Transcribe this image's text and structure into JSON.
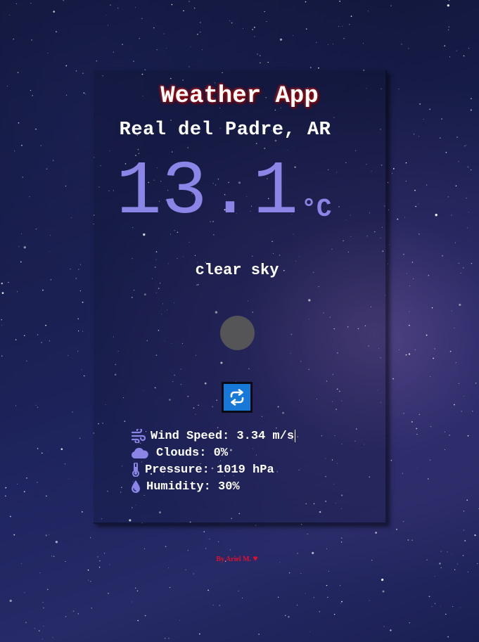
{
  "app": {
    "title": "Weather App",
    "location": "Real del Padre, AR"
  },
  "current": {
    "temperature": "13.1",
    "unit": "°C",
    "description": "clear sky"
  },
  "actions": {
    "refresh_icon": "refresh-icon"
  },
  "stats": [
    {
      "icon": "wind-icon",
      "label": "Wind Speed:",
      "value": "3.34 m/s"
    },
    {
      "icon": "cloud-icon",
      "label": "Clouds:",
      "value": "0%"
    },
    {
      "icon": "thermometer-icon",
      "label": "Pressure:",
      "value": "1019 hPa"
    },
    {
      "icon": "droplet-icon",
      "label": "Humidity:",
      "value": "30%"
    }
  ],
  "footer": {
    "credit": "By Ariel M.",
    "heart": "♥"
  },
  "colors": {
    "accent": "#8a85e6",
    "button": "#1878d8",
    "footer": "#e01030",
    "icon_placeholder": "#555456"
  }
}
